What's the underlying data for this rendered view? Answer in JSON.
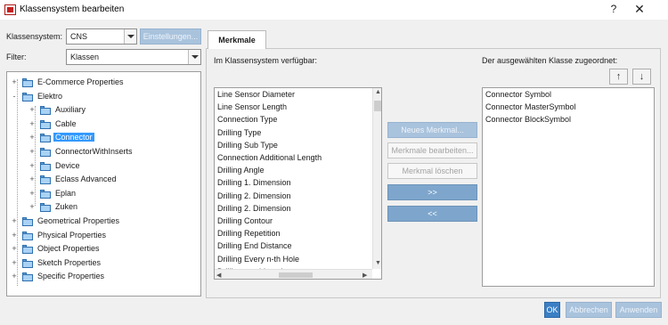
{
  "window": {
    "title": "Klassensystem bearbeiten",
    "help_glyph": "?",
    "close_glyph": "✕"
  },
  "toolbar": {
    "klassensystem_label": "Klassensystem:",
    "klassensystem_value": "CNS",
    "einstellungen_label": "Einstellungen...",
    "filter_label": "Filter:",
    "filter_value": "Klassen"
  },
  "tree": {
    "items": [
      {
        "label": "E-Commerce Properties",
        "level": 0,
        "expander": "+"
      },
      {
        "label": "Elektro",
        "level": 0,
        "expander": "-"
      },
      {
        "label": "Auxiliary",
        "level": 1,
        "expander": "+"
      },
      {
        "label": "Cable",
        "level": 1,
        "expander": "+"
      },
      {
        "label": "Connector",
        "level": 1,
        "expander": "+",
        "selected": true
      },
      {
        "label": "ConnectorWithInserts",
        "level": 1,
        "expander": "+"
      },
      {
        "label": "Device",
        "level": 1,
        "expander": "+"
      },
      {
        "label": "Eclass Advanced",
        "level": 1,
        "expander": "+"
      },
      {
        "label": "Eplan",
        "level": 1,
        "expander": "+"
      },
      {
        "label": "Zuken",
        "level": 1,
        "expander": "+"
      },
      {
        "label": "Geometrical Properties",
        "level": 0,
        "expander": "+"
      },
      {
        "label": "Physical Properties",
        "level": 0,
        "expander": "+"
      },
      {
        "label": "Object Properties",
        "level": 0,
        "expander": "+"
      },
      {
        "label": "Sketch Properties",
        "level": 0,
        "expander": "+"
      },
      {
        "label": "Specific Properties",
        "level": 0,
        "expander": "+"
      }
    ]
  },
  "tabs": {
    "merkmale": "Merkmale"
  },
  "available": {
    "heading": "Im Klassensystem verfügbar:",
    "items": [
      "Line Sensor Diameter",
      "Line Sensor Length",
      "Connection Type",
      "Drilling Type",
      "Drilling Sub Type",
      "Connection Additional Length",
      "Drilling Angle",
      "Drilling 1. Dimension",
      "Drilling 2. Dimension",
      "Drilling 2. Dimension",
      "Drilling Contour",
      "Drilling Repetition",
      "Drilling End Distance",
      "Drilling Every n-th Hole",
      "Drilling machine always"
    ]
  },
  "middle_buttons": {
    "neues": "Neues Merkmal...",
    "bearbeiten": "Merkmale bearbeiten...",
    "loeschen": "Merkmal löschen",
    "add": ">>",
    "remove": "<<"
  },
  "assigned": {
    "heading": "Der ausgewählten Klasse zugeordnet:",
    "items": [
      "Connector Symbol",
      "Connector MasterSymbol",
      "Connector BlockSymbol"
    ],
    "up_glyph": "↑",
    "down_glyph": "↓"
  },
  "footer": {
    "ok": "OK",
    "abbrechen": "Abbrechen",
    "anwenden": "Anwenden"
  },
  "colors": {
    "accent": "#3b7fc4",
    "selection": "#3399ff",
    "button_blue": "#7ea6cc"
  }
}
